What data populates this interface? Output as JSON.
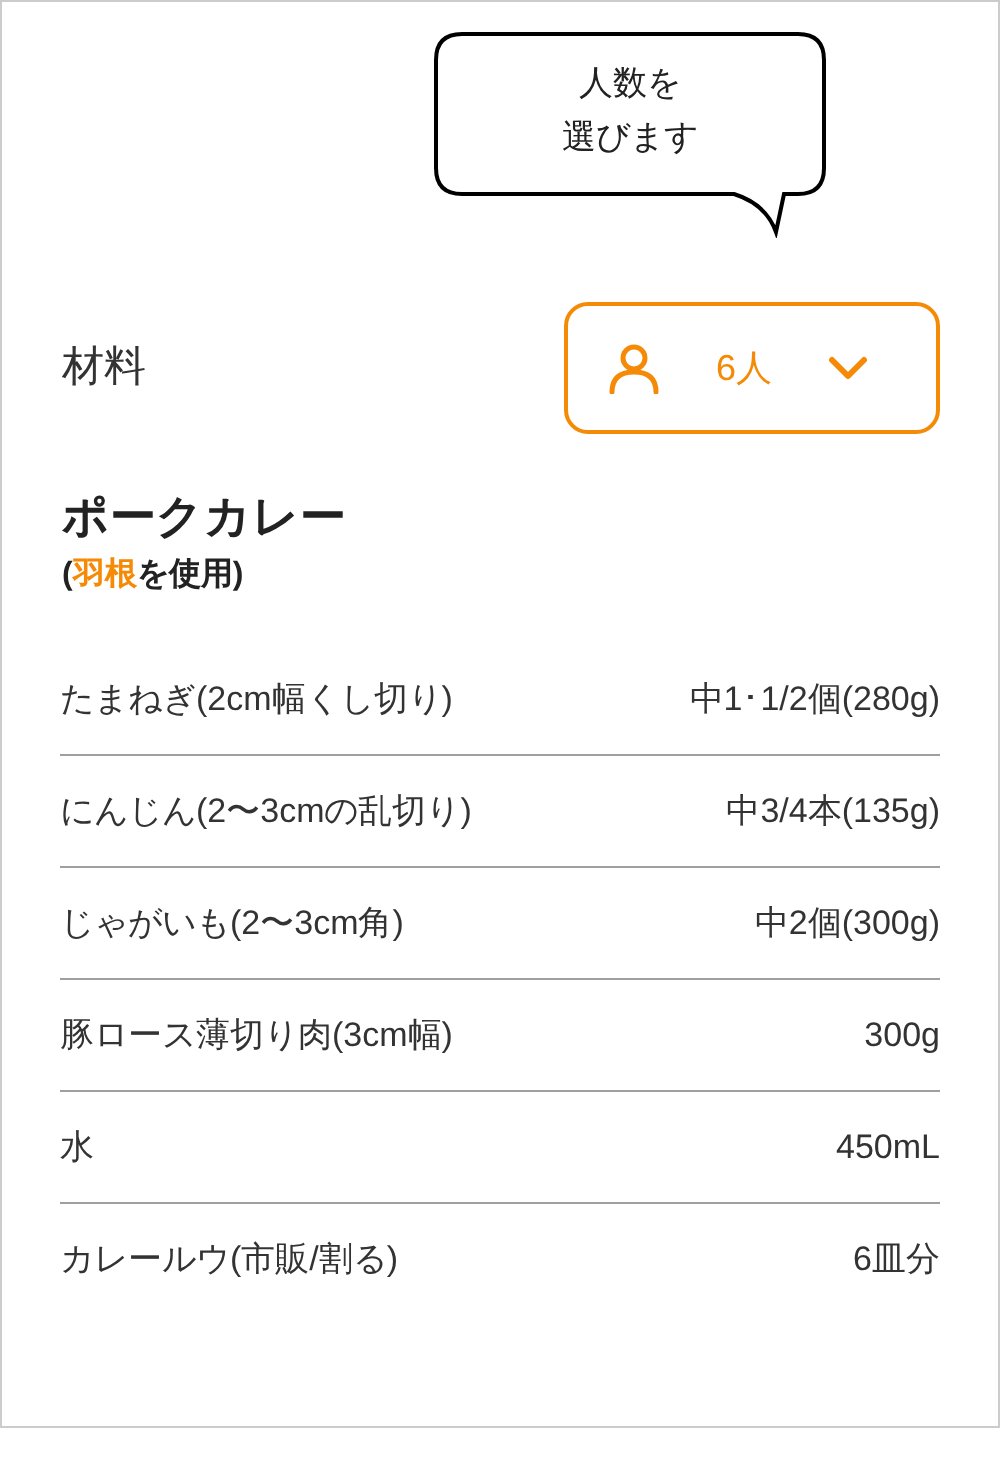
{
  "bubble": {
    "lines": [
      "人数を",
      "選びます"
    ]
  },
  "section": {
    "title": "材料"
  },
  "servings": {
    "value": "6人"
  },
  "recipe": {
    "title": "ポークカレー",
    "subtitle": [
      {
        "text": "(",
        "highlight": false
      },
      {
        "text": "羽根",
        "highlight": true
      },
      {
        "text": "を使用)",
        "highlight": false
      }
    ]
  },
  "ingredients": [
    {
      "name": "たまねぎ(2cm幅くし切り)",
      "amount": "中1･1/2個(280g)"
    },
    {
      "name": "にんじん(2〜3cmの乱切り)",
      "amount": "中3/4本(135g)"
    },
    {
      "name": "じゃがいも(2〜3cm角)",
      "amount": "中2個(300g)"
    },
    {
      "name": "豚ロース薄切り肉(3cm幅)",
      "amount": "300g"
    },
    {
      "name": "水",
      "amount": "450mL"
    },
    {
      "name": "カレールウ(市販/割る)",
      "amount": "6皿分"
    }
  ]
}
